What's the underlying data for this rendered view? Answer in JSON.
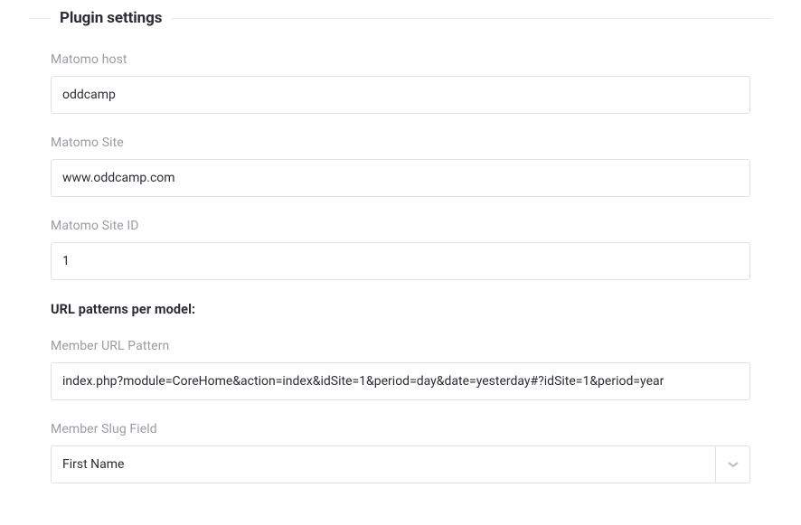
{
  "legend": "Plugin settings",
  "fields": {
    "host": {
      "label": "Matomo host",
      "value": "oddcamp"
    },
    "site": {
      "label": "Matomo Site",
      "value": "www.oddcamp.com"
    },
    "siteId": {
      "label": "Matomo Site ID",
      "value": "1"
    }
  },
  "sectionHeading": "URL patterns per model:",
  "patterns": {
    "memberUrl": {
      "label": "Member URL Pattern",
      "value": "index.php?module=CoreHome&action=index&idSite=1&period=day&date=yesterday#?idSite=1&period=year"
    },
    "memberSlug": {
      "label": "Member Slug Field",
      "selected": "First Name"
    }
  }
}
